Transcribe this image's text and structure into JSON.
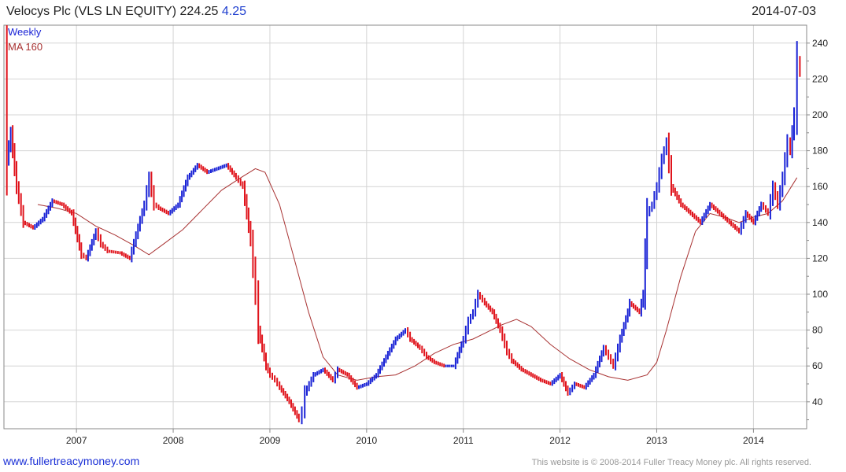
{
  "header": {
    "title": "Velocys Plc (VLS LN EQUITY)",
    "price": "224.25",
    "change": "4.25",
    "date": "2014-07-03"
  },
  "legend": {
    "period": "Weekly",
    "ma_label": "MA 160"
  },
  "footer": {
    "site": "www.fullertreacymoney.com",
    "copyright": "This website is © 2008-2014 Fuller Treacy Money plc. All rights reserved."
  },
  "colors": {
    "up": "#1a23d6",
    "down": "#e0141c",
    "ma": "#a83232",
    "grid": "#d4d4d4",
    "frame": "#8a8a8a"
  },
  "chart_data": {
    "type": "line",
    "title": "Velocys Plc (VLS LN EQUITY)",
    "frequency": "Weekly",
    "xlim": [
      2006.25,
      2014.55
    ],
    "ylim": [
      25,
      250
    ],
    "x_tick_labels": [
      2007,
      2008,
      2009,
      2010,
      2011,
      2012,
      2013,
      2014
    ],
    "y_tick_labels": [
      40,
      60,
      80,
      100,
      120,
      140,
      160,
      180,
      200,
      220,
      240
    ],
    "grid": true,
    "legend_position": "top-left",
    "series": [
      {
        "name": "Weekly",
        "style": "price bars",
        "x": [
          2006.25,
          2006.28,
          2006.32,
          2006.38,
          2006.45,
          2006.55,
          2006.65,
          2006.75,
          2006.85,
          2006.95,
          2007.05,
          2007.1,
          2007.2,
          2007.25,
          2007.32,
          2007.45,
          2007.55,
          2007.7,
          2007.75,
          2007.8,
          2007.85,
          2007.95,
          2008.05,
          2008.15,
          2008.25,
          2008.35,
          2008.45,
          2008.55,
          2008.65,
          2008.72,
          2008.8,
          2008.85,
          2008.88,
          2008.92,
          2008.96,
          2009.0,
          2009.05,
          2009.1,
          2009.2,
          2009.3,
          2009.33,
          2009.36,
          2009.45,
          2009.55,
          2009.65,
          2009.7,
          2009.8,
          2009.9,
          2010.0,
          2010.1,
          2010.2,
          2010.3,
          2010.4,
          2010.45,
          2010.55,
          2010.62,
          2010.7,
          2010.8,
          2010.9,
          2011.0,
          2011.05,
          2011.1,
          2011.15,
          2011.22,
          2011.3,
          2011.38,
          2011.45,
          2011.5,
          2011.6,
          2011.7,
          2011.8,
          2011.9,
          2012.0,
          2012.08,
          2012.15,
          2012.25,
          2012.35,
          2012.45,
          2012.5,
          2012.55,
          2012.62,
          2012.7,
          2012.72,
          2012.78,
          2012.82,
          2012.86,
          2012.9,
          2012.95,
          2013.0,
          2013.05,
          2013.1,
          2013.15,
          2013.25,
          2013.35,
          2013.45,
          2013.55,
          2013.65,
          2013.75,
          2013.85,
          2013.92,
          2014.0,
          2014.08,
          2014.15,
          2014.2,
          2014.25,
          2014.3,
          2014.35,
          2014.38,
          2014.42,
          2014.45,
          2014.48
        ],
        "y": [
          230,
          175,
          190,
          160,
          140,
          137,
          142,
          152,
          150,
          145,
          122,
          120,
          135,
          128,
          124,
          123,
          120,
          150,
          165,
          150,
          148,
          145,
          150,
          165,
          172,
          168,
          170,
          172,
          165,
          160,
          130,
          100,
          80,
          70,
          60,
          55,
          52,
          48,
          40,
          30,
          35,
          45,
          55,
          58,
          52,
          58,
          55,
          48,
          50,
          55,
          65,
          75,
          80,
          75,
          70,
          65,
          62,
          60,
          60,
          75,
          85,
          90,
          100,
          95,
          90,
          80,
          68,
          63,
          58,
          55,
          52,
          50,
          55,
          45,
          50,
          48,
          55,
          70,
          65,
          60,
          75,
          90,
          95,
          92,
          90,
          100,
          145,
          150,
          160,
          175,
          185,
          160,
          150,
          145,
          140,
          150,
          145,
          140,
          135,
          145,
          140,
          150,
          145,
          160,
          150,
          165,
          185,
          180,
          200,
          230,
          224
        ]
      },
      {
        "name": "MA 160",
        "style": "line",
        "x": [
          2006.6,
          2006.8,
          2007.0,
          2007.2,
          2007.4,
          2007.6,
          2007.75,
          2007.9,
          2008.1,
          2008.3,
          2008.5,
          2008.7,
          2008.85,
          2008.95,
          2009.1,
          2009.25,
          2009.4,
          2009.55,
          2009.7,
          2009.9,
          2010.1,
          2010.3,
          2010.5,
          2010.7,
          2010.9,
          2011.1,
          2011.25,
          2011.4,
          2011.55,
          2011.7,
          2011.9,
          2012.1,
          2012.3,
          2012.5,
          2012.7,
          2012.9,
          2013.0,
          2013.1,
          2013.25,
          2013.4,
          2013.55,
          2013.7,
          2013.85,
          2014.0,
          2014.15,
          2014.3,
          2014.45
        ],
        "y": [
          150,
          148,
          145,
          138,
          133,
          127,
          122,
          128,
          136,
          147,
          158,
          165,
          170,
          168,
          150,
          120,
          90,
          65,
          55,
          52,
          54,
          55,
          60,
          67,
          72,
          75,
          79,
          83,
          86,
          82,
          72,
          64,
          58,
          54,
          52,
          55,
          62,
          80,
          110,
          135,
          145,
          143,
          140,
          143,
          145,
          152,
          165
        ]
      }
    ]
  }
}
